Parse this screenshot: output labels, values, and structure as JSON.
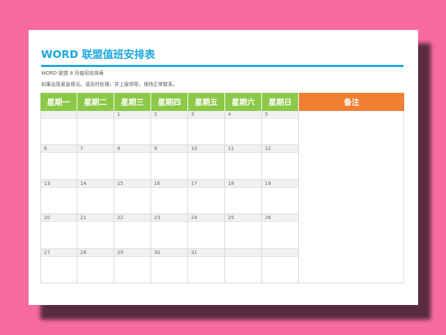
{
  "document": {
    "title": "WORD 联盟值班安排表",
    "subtitle": "WORD 联盟 8 月值班安排表",
    "note": "如果出现紧急情况，请及时处理，并上报领导，保持正常联系。"
  },
  "calendar": {
    "day_headers": [
      "星期一",
      "星期二",
      "星期三",
      "星期四",
      "星期五",
      "星期六",
      "星期日"
    ],
    "notes_header": "备注",
    "weeks": [
      [
        "",
        "",
        "1",
        "2",
        "3",
        "4",
        "5"
      ],
      [
        "6",
        "7",
        "8",
        "9",
        "10",
        "11",
        "12"
      ],
      [
        "13",
        "14",
        "15",
        "16",
        "17",
        "18",
        "19"
      ],
      [
        "20",
        "21",
        "22",
        "23",
        "24",
        "25",
        "26"
      ],
      [
        "27",
        "28",
        "29",
        "30",
        "31",
        "",
        ""
      ]
    ]
  },
  "colors": {
    "background": "#f76aa0",
    "title": "#1aa7df",
    "day_header": "#8cc949",
    "notes_header": "#ee7f33"
  }
}
